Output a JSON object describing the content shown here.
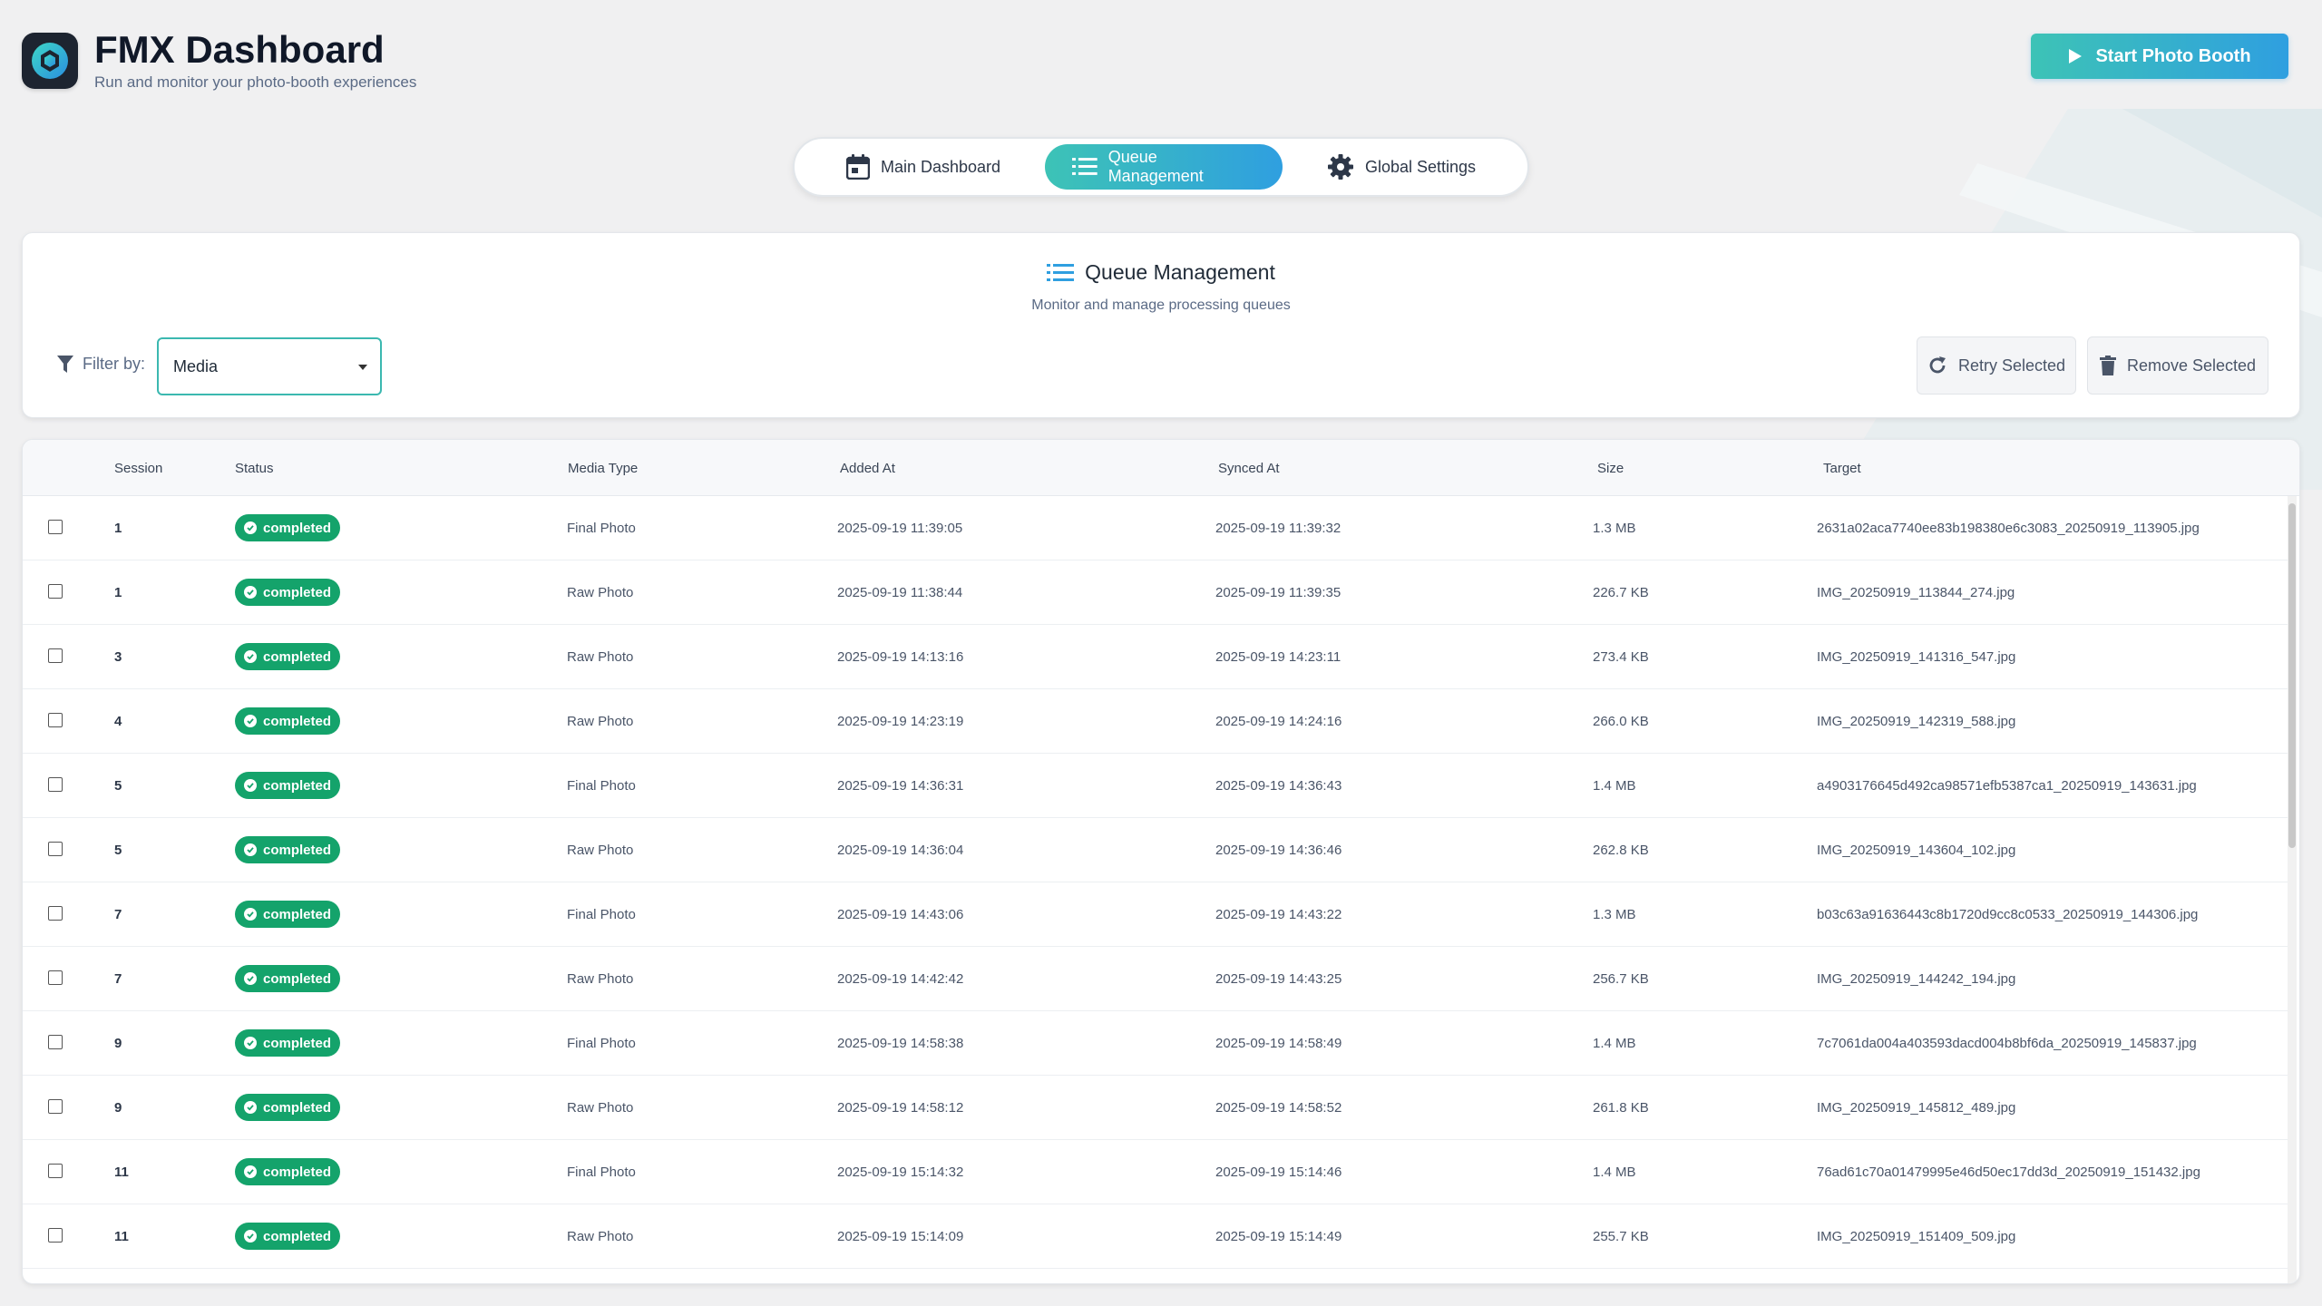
{
  "header": {
    "title": "FMX Dashboard",
    "subtitle": "Run and monitor your photo-booth experiences",
    "start_button": "Start Photo Booth"
  },
  "tabs": [
    {
      "label": "Main Dashboard",
      "icon": "calendar-icon",
      "active": false
    },
    {
      "label": "Queue Management",
      "icon": "list-icon",
      "active": true
    },
    {
      "label": "Global Settings",
      "icon": "gear-icon",
      "active": false
    }
  ],
  "queue": {
    "title": "Queue Management",
    "subtitle": "Monitor and manage processing queues",
    "filter_label": "Filter by:",
    "filter_value": "Media",
    "retry_label": "Retry Selected",
    "remove_label": "Remove Selected"
  },
  "table": {
    "columns": [
      "Session",
      "Status",
      "Media Type",
      "Added At",
      "Synced At",
      "Size",
      "Target"
    ],
    "rows": [
      {
        "session": "1",
        "status": "completed",
        "media_type": "Final Photo",
        "added_at": "2025-09-19 11:39:05",
        "synced_at": "2025-09-19 11:39:32",
        "size": "1.3 MB",
        "target": "2631a02aca7740ee83b198380e6c3083_20250919_113905.jpg"
      },
      {
        "session": "1",
        "status": "completed",
        "media_type": "Raw Photo",
        "added_at": "2025-09-19 11:38:44",
        "synced_at": "2025-09-19 11:39:35",
        "size": "226.7 KB",
        "target": "IMG_20250919_113844_274.jpg"
      },
      {
        "session": "3",
        "status": "completed",
        "media_type": "Raw Photo",
        "added_at": "2025-09-19 14:13:16",
        "synced_at": "2025-09-19 14:23:11",
        "size": "273.4 KB",
        "target": "IMG_20250919_141316_547.jpg"
      },
      {
        "session": "4",
        "status": "completed",
        "media_type": "Raw Photo",
        "added_at": "2025-09-19 14:23:19",
        "synced_at": "2025-09-19 14:24:16",
        "size": "266.0 KB",
        "target": "IMG_20250919_142319_588.jpg"
      },
      {
        "session": "5",
        "status": "completed",
        "media_type": "Final Photo",
        "added_at": "2025-09-19 14:36:31",
        "synced_at": "2025-09-19 14:36:43",
        "size": "1.4 MB",
        "target": "a4903176645d492ca98571efb5387ca1_20250919_143631.jpg"
      },
      {
        "session": "5",
        "status": "completed",
        "media_type": "Raw Photo",
        "added_at": "2025-09-19 14:36:04",
        "synced_at": "2025-09-19 14:36:46",
        "size": "262.8 KB",
        "target": "IMG_20250919_143604_102.jpg"
      },
      {
        "session": "7",
        "status": "completed",
        "media_type": "Final Photo",
        "added_at": "2025-09-19 14:43:06",
        "synced_at": "2025-09-19 14:43:22",
        "size": "1.3 MB",
        "target": "b03c63a91636443c8b1720d9cc8c0533_20250919_144306.jpg"
      },
      {
        "session": "7",
        "status": "completed",
        "media_type": "Raw Photo",
        "added_at": "2025-09-19 14:42:42",
        "synced_at": "2025-09-19 14:43:25",
        "size": "256.7 KB",
        "target": "IMG_20250919_144242_194.jpg"
      },
      {
        "session": "9",
        "status": "completed",
        "media_type": "Final Photo",
        "added_at": "2025-09-19 14:58:38",
        "synced_at": "2025-09-19 14:58:49",
        "size": "1.4 MB",
        "target": "7c7061da004a403593dacd004b8bf6da_20250919_145837.jpg"
      },
      {
        "session": "9",
        "status": "completed",
        "media_type": "Raw Photo",
        "added_at": "2025-09-19 14:58:12",
        "synced_at": "2025-09-19 14:58:52",
        "size": "261.8 KB",
        "target": "IMG_20250919_145812_489.jpg"
      },
      {
        "session": "11",
        "status": "completed",
        "media_type": "Final Photo",
        "added_at": "2025-09-19 15:14:32",
        "synced_at": "2025-09-19 15:14:46",
        "size": "1.4 MB",
        "target": "76ad61c70a01479995e46d50ec17dd3d_20250919_151432.jpg"
      },
      {
        "session": "11",
        "status": "completed",
        "media_type": "Raw Photo",
        "added_at": "2025-09-19 15:14:09",
        "synced_at": "2025-09-19 15:14:49",
        "size": "255.7 KB",
        "target": "IMG_20250919_151409_509.jpg"
      }
    ]
  },
  "colors": {
    "accent_start": "#3dc3b6",
    "accent_end": "#2f9fe0",
    "completed_badge": "#14a36b",
    "filter_border": "#3bb8b0"
  }
}
